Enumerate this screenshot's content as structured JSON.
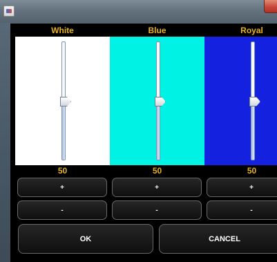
{
  "window": {
    "title": ""
  },
  "channels": [
    {
      "name": "White",
      "color": "#ffffff",
      "value": "50",
      "slider_level": 0.5,
      "plus_label": "+",
      "minus_label": "-"
    },
    {
      "name": "Blue",
      "color": "#00f2e4",
      "value": "50",
      "slider_level": 0.5,
      "plus_label": "+",
      "minus_label": "-"
    },
    {
      "name": "Royal",
      "color": "#1422e0",
      "value": "50",
      "slider_level": 0.5,
      "plus_label": "+",
      "minus_label": "-"
    }
  ],
  "footer": {
    "ok_label": "OK",
    "cancel_label": "CANCEL"
  },
  "theme": {
    "label_color": "#e7b21f",
    "panel_background": "#000000"
  }
}
